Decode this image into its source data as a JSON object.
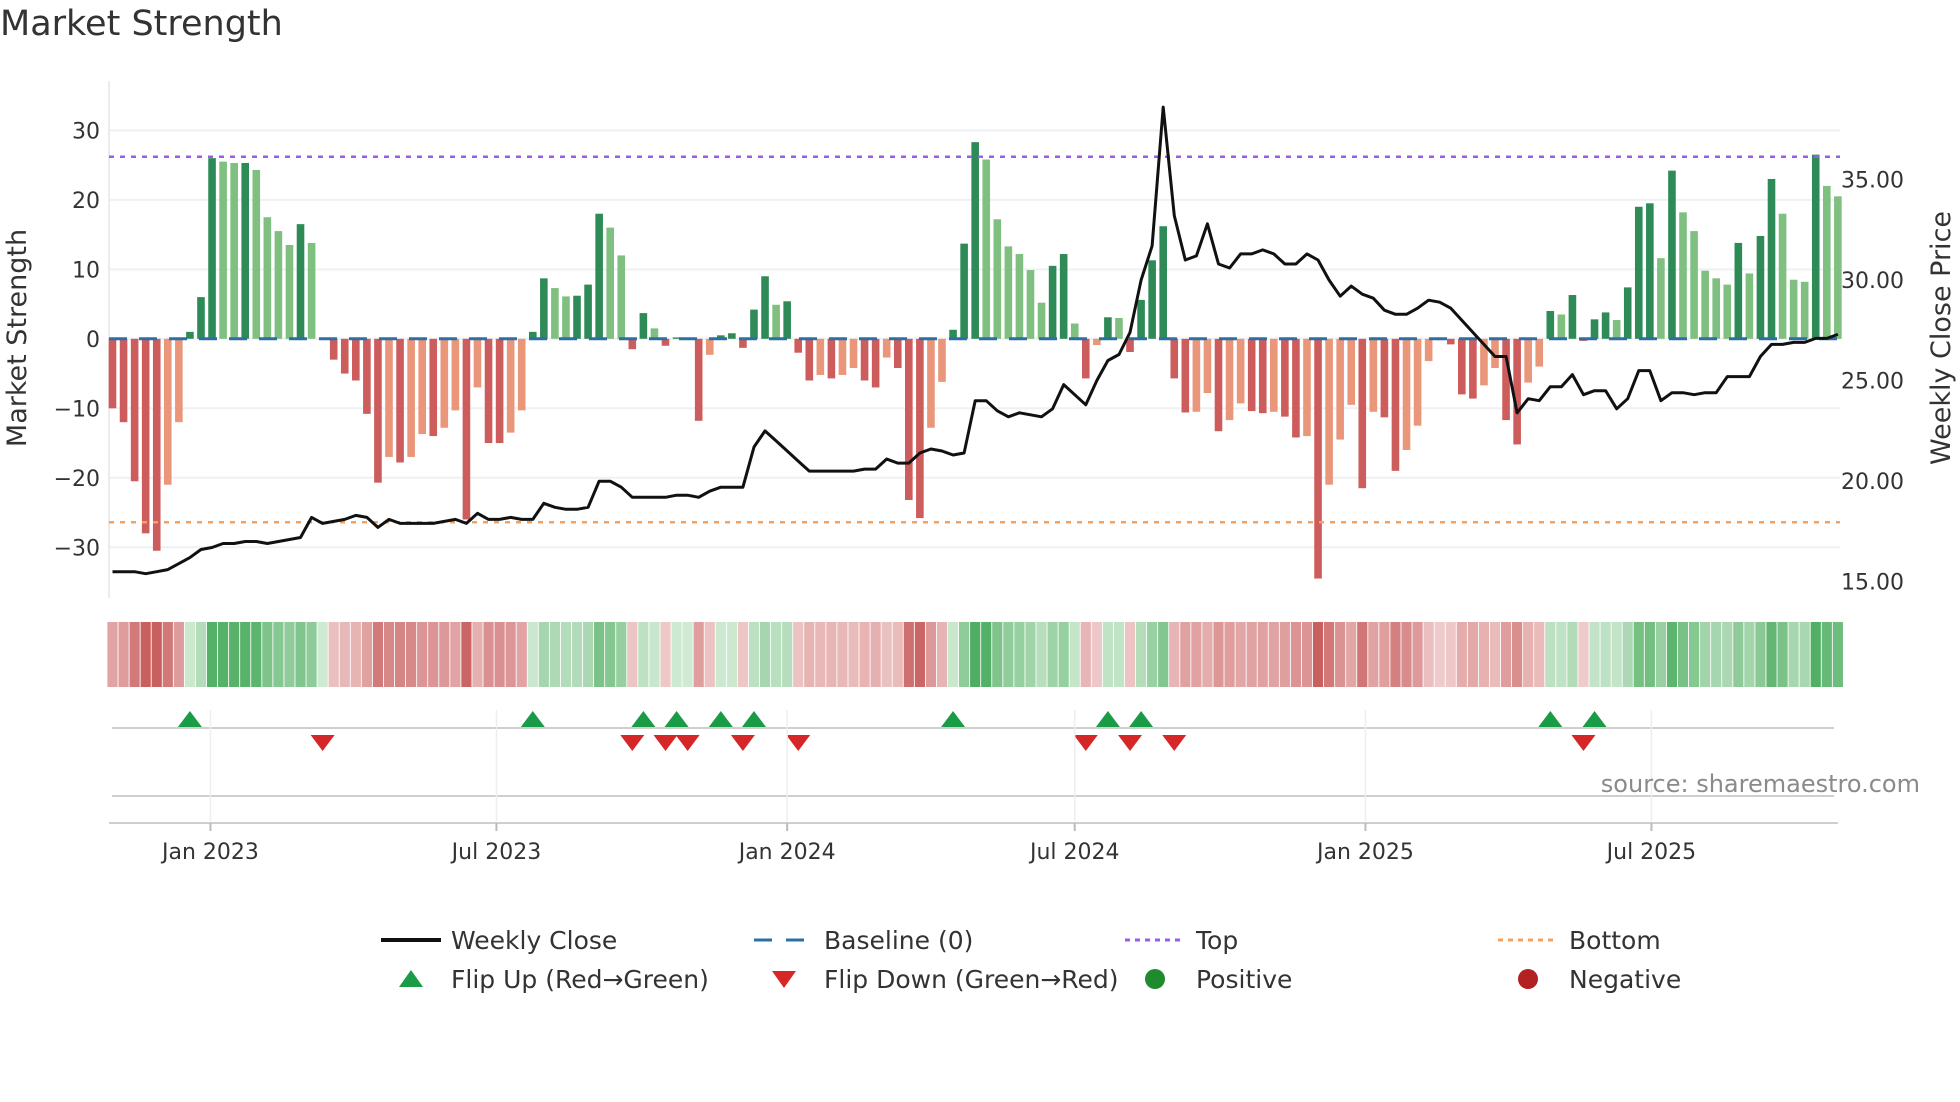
{
  "title": "Market Strength",
  "source": "source: sharemaestro.com",
  "chart_data": {
    "type": "bar",
    "title": "Market Strength",
    "ylabel": "Market Strength",
    "y2label": "Weekly Close Price",
    "frequency": "weekly",
    "start_date": "2022-10-31",
    "ylim": [
      -37.3,
      37.1
    ],
    "y2lim": [
      14.19,
      39.9
    ],
    "yticks": [
      30,
      20,
      10,
      0,
      -10,
      -20,
      -30
    ],
    "ytick_labels": [
      "30",
      "20",
      "10",
      "0",
      "−10",
      "−20",
      "−30"
    ],
    "y2ticks": [
      35,
      30,
      25,
      20,
      15
    ],
    "y2tick_labels": [
      "35.00",
      "30.00",
      "25.00",
      "20.00",
      "15.00"
    ],
    "xticks": [
      "2023-01-01",
      "2023-07-01",
      "2024-01-01",
      "2024-07-01",
      "2025-01-01",
      "2025-07-01"
    ],
    "xtick_labels": [
      "Jan 2023",
      "Jul 2023",
      "Jan 2024",
      "Jul 2024",
      "Jan 2025",
      "Jul 2025"
    ],
    "top": 26.2,
    "bottom": -26.4,
    "baseline": 0,
    "grid": true,
    "legend_position": "bottom",
    "strength": [
      -10,
      -12,
      -20.5,
      -28,
      -30.5,
      -21,
      -12,
      1,
      6,
      26,
      25.5,
      25.3,
      25.3,
      24.3,
      17.5,
      15.5,
      13.5,
      16.5,
      13.8,
      0,
      -3,
      -5,
      -6,
      -10.8,
      -20.7,
      -17,
      -17.8,
      -17,
      -13.7,
      -14,
      -12.8,
      -10.3,
      -26,
      -7,
      -15,
      -15,
      -13.5,
      -10.3,
      1,
      8.7,
      7.3,
      6.1,
      6.2,
      7.8,
      18,
      16,
      12,
      -1.5,
      3.7,
      1.5,
      -1,
      0.2,
      0,
      -11.8,
      -2.3,
      0.5,
      0.8,
      -1.3,
      4.2,
      9,
      4.9,
      5.4,
      -2,
      -6,
      -5.2,
      -5.7,
      -5.2,
      -4.2,
      -6,
      -7,
      -2.7,
      -4.2,
      -23.2,
      -25.8,
      -12.8,
      -6.2,
      1.3,
      13.7,
      28.3,
      25.8,
      17.2,
      13.3,
      12.2,
      9.9,
      5.2,
      10.5,
      12.2,
      2.2,
      -5.7,
      -0.9,
      3.1,
      3,
      -1.9,
      5.6,
      11.3,
      16.2,
      -5.7,
      -10.6,
      -10.5,
      -7.8,
      -13.3,
      -11.7,
      -9.3,
      -10.4,
      -10.7,
      -10.5,
      -11.2,
      -14.2,
      -14,
      -34.5,
      -21,
      -14.5,
      -9.5,
      -21.5,
      -10.5,
      -11.3,
      -19,
      -16,
      -12.5,
      -3.2,
      -0.2,
      -0.8,
      -8,
      -8.6,
      -6.7,
      -4.2,
      -11.7,
      -15.2,
      -6.3,
      -4,
      4,
      3.5,
      6.3,
      -0.3,
      2.8,
      3.8,
      2.7,
      7.4,
      19,
      19.5,
      11.6,
      24.2,
      18.2,
      15.5,
      9.8,
      8.7,
      7.8,
      13.8,
      9.4,
      14.8,
      23,
      18,
      8.5,
      8.2,
      26.5,
      22,
      20.5
    ],
    "weekly_close": [
      15.5,
      15.5,
      15.5,
      15.4,
      15.5,
      15.6,
      15.9,
      16.2,
      16.6,
      16.7,
      16.9,
      16.9,
      17.0,
      17.0,
      16.9,
      17.0,
      17.1,
      17.2,
      18.2,
      17.9,
      18.0,
      18.1,
      18.3,
      18.2,
      17.7,
      18.1,
      17.9,
      17.9,
      17.9,
      17.9,
      18.0,
      18.1,
      17.9,
      18.4,
      18.1,
      18.1,
      18.2,
      18.1,
      18.1,
      18.9,
      18.7,
      18.6,
      18.6,
      18.7,
      20.0,
      20.0,
      19.7,
      19.2,
      19.2,
      19.2,
      19.2,
      19.3,
      19.3,
      19.2,
      19.5,
      19.7,
      19.7,
      19.7,
      21.7,
      22.5,
      22.0,
      21.5,
      21.0,
      20.5,
      20.5,
      20.5,
      20.5,
      20.5,
      20.6,
      20.6,
      21.1,
      20.9,
      20.9,
      21.4,
      21.6,
      21.5,
      21.3,
      21.4,
      24.0,
      24.0,
      23.5,
      23.2,
      23.4,
      23.3,
      23.2,
      23.6,
      24.8,
      24.3,
      23.8,
      25.0,
      26.0,
      26.3,
      27.4,
      30.0,
      31.7,
      38.6,
      33.2,
      31.0,
      31.2,
      32.8,
      30.8,
      30.6,
      31.3,
      31.3,
      31.5,
      31.3,
      30.8,
      30.8,
      31.3,
      31.0,
      30.0,
      29.2,
      29.7,
      29.3,
      29.1,
      28.5,
      28.3,
      28.3,
      28.6,
      29.0,
      28.9,
      28.6,
      28.0,
      27.4,
      26.8,
      26.2,
      26.2,
      23.4,
      24.1,
      24.0,
      24.7,
      24.7,
      25.3,
      24.3,
      24.5,
      24.5,
      23.6,
      24.1,
      25.5,
      25.5,
      24.0,
      24.4,
      24.4,
      24.3,
      24.4,
      24.4,
      25.2,
      25.2,
      25.2,
      26.2,
      26.8,
      26.8,
      26.9,
      26.9,
      27.1,
      27.1,
      27.3
    ],
    "flip_up": [
      "2022-12-19",
      "2023-07-24",
      "2023-10-02",
      "2023-10-23",
      "2023-11-20",
      "2023-12-11",
      "2024-04-15",
      "2024-07-22",
      "2024-08-12",
      "2025-04-28",
      "2025-05-26"
    ],
    "flip_down": [
      "2023-03-13",
      "2023-09-25",
      "2023-10-16",
      "2023-10-30",
      "2023-12-04",
      "2024-01-08",
      "2024-07-08",
      "2024-08-05",
      "2024-09-02",
      "2025-05-19"
    ],
    "positive_markers": [],
    "negative_markers": [],
    "colors": {
      "pos_strong": "#2e8b57",
      "pos_weak": "#7fbf7f",
      "neg_strong": "#cd5c5c",
      "neg_weak": "#e9967a",
      "close": "#111111",
      "baseline": "#2c6fa6",
      "top": "#9b5de5",
      "bottom": "#f4a261",
      "flip_up": "#1a9c46",
      "flip_down": "#d62728",
      "positive": "#1f8b2c",
      "negative": "#b22222"
    },
    "legend": [
      {
        "label": "Weekly Close",
        "kind": "line"
      },
      {
        "label": "Baseline (0)",
        "kind": "dash"
      },
      {
        "label": "Top",
        "kind": "dot-top"
      },
      {
        "label": "Bottom",
        "kind": "dot-bottom"
      },
      {
        "label": "Flip Up (Red→Green)",
        "kind": "tri-up"
      },
      {
        "label": "Flip Down (Green→Red)",
        "kind": "tri-down"
      },
      {
        "label": "Positive",
        "kind": "circle-pos"
      },
      {
        "label": "Negative",
        "kind": "circle-neg"
      }
    ]
  }
}
